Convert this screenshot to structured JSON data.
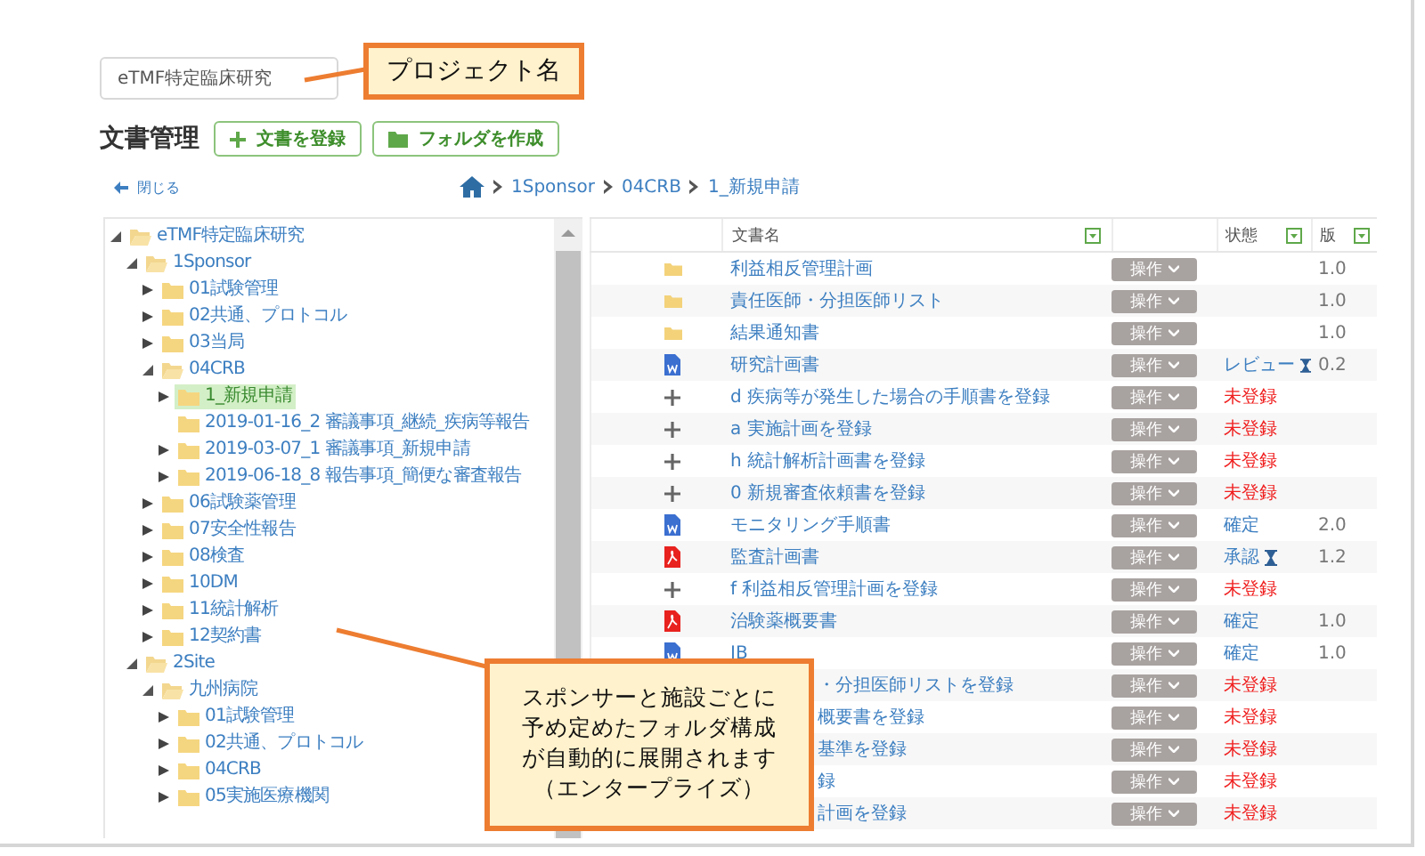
{
  "project_field": {
    "value": "eTMF特定臨床研究"
  },
  "callouts": [
    {
      "kind": "title",
      "text": "プロジェクト名"
    },
    {
      "kind": "note",
      "lines": [
        "スポンサーと施設ごとに",
        "予め定めたフォルダ構成",
        "が自動的に展開されます",
        "（エンタープライズ）"
      ]
    }
  ],
  "heading": "文書管理",
  "buttons": [
    {
      "kind": "add",
      "label": "文書を登録"
    },
    {
      "kind": "folder",
      "label": "フォルダを作成"
    }
  ],
  "close_link": "閉じる",
  "breadcrumb": [
    "1Sponsor",
    "04CRB",
    "1_新規申請"
  ],
  "tree": [
    {
      "label": "eTMF特定臨床研究",
      "expanded": true,
      "selected": false,
      "children": [
        {
          "label": "1Sponsor",
          "expanded": true,
          "selected": false,
          "children": [
            {
              "label": "01試験管理",
              "expanded": false,
              "selected": false
            },
            {
              "label": "02共通、プロトコル",
              "expanded": false,
              "selected": false
            },
            {
              "label": "03当局",
              "expanded": false,
              "selected": false
            },
            {
              "label": "04CRB",
              "expanded": true,
              "selected": false,
              "children": [
                {
                  "label": "1_新規申請",
                  "expanded": false,
                  "selected": true
                },
                {
                  "label": "2019-01-16_2 審議事項_継続_疾病等報告",
                  "selected": false
                },
                {
                  "label": "2019-03-07_1 審議事項_新規申請",
                  "expanded": false,
                  "selected": false
                },
                {
                  "label": "2019-06-18_8 報告事項_簡便な審査報告",
                  "expanded": false,
                  "selected": false
                }
              ]
            },
            {
              "label": "06試験薬管理",
              "expanded": false,
              "selected": false
            },
            {
              "label": "07安全性報告",
              "expanded": false,
              "selected": false
            },
            {
              "label": "08検査",
              "expanded": false,
              "selected": false
            },
            {
              "label": "10DM",
              "expanded": false,
              "selected": false
            },
            {
              "label": "11統計解析",
              "expanded": false,
              "selected": false
            },
            {
              "label": "12契約書",
              "expanded": false,
              "selected": false
            }
          ]
        },
        {
          "label": "2Site",
          "expanded": true,
          "selected": false,
          "children": [
            {
              "label": "九州病院",
              "expanded": true,
              "selected": false,
              "children": [
                {
                  "label": "01試験管理",
                  "expanded": false,
                  "selected": false
                },
                {
                  "label": "02共通、プロトコル",
                  "expanded": false,
                  "selected": false
                },
                {
                  "label": "04CRB",
                  "expanded": false,
                  "selected": false
                },
                {
                  "label": "05実施医療機関",
                  "expanded": false,
                  "selected": false
                }
              ]
            }
          ]
        }
      ]
    }
  ],
  "table": {
    "columns": [
      "文書名",
      "状態",
      "版"
    ],
    "rows": [
      {
        "kind": "folder",
        "name": "利益相反管理計画",
        "action": "操作",
        "version": "1.0"
      },
      {
        "kind": "folder",
        "name": "責任医師・分担医師リスト",
        "action": "操作",
        "version": "1.0"
      },
      {
        "kind": "folder",
        "name": "結果通知書",
        "action": "操作",
        "version": "1.0"
      },
      {
        "kind": "word",
        "name": "研究計画書",
        "action": "操作",
        "status": {
          "text": "レビュー",
          "kind": "pending"
        },
        "version": "0.2"
      },
      {
        "kind": "plus",
        "name": "d 疾病等が発生した場合の手順書を登録",
        "action": "操作",
        "status": {
          "text": "未登録",
          "kind": "missing"
        }
      },
      {
        "kind": "plus",
        "name": "a 実施計画を登録",
        "action": "操作",
        "status": {
          "text": "未登録",
          "kind": "missing"
        }
      },
      {
        "kind": "plus",
        "name": "h 統計解析計画書を登録",
        "action": "操作",
        "status": {
          "text": "未登録",
          "kind": "missing"
        }
      },
      {
        "kind": "plus",
        "name": "0 新規審査依頼書を登録",
        "action": "操作",
        "status": {
          "text": "未登録",
          "kind": "missing"
        }
      },
      {
        "kind": "word",
        "name": "モニタリング手順書",
        "action": "操作",
        "status": {
          "text": "確定",
          "kind": "done"
        },
        "version": "2.0"
      },
      {
        "kind": "pdf",
        "name": "監査計画書",
        "action": "操作",
        "status": {
          "text": "承認",
          "kind": "pending"
        },
        "version": "1.2"
      },
      {
        "kind": "plus",
        "name": "f 利益相反管理計画を登録",
        "action": "操作",
        "status": {
          "text": "未登録",
          "kind": "missing"
        }
      },
      {
        "kind": "pdf",
        "name": "治験薬概要書",
        "action": "操作",
        "status": {
          "text": "確定",
          "kind": "done"
        },
        "version": "1.0"
      },
      {
        "kind": "word",
        "name": "IB",
        "action": "操作",
        "status": {
          "text": "確定",
          "kind": "done"
        },
        "version": "1.0"
      },
      {
        "kind": "covered",
        "name": "・分担医師リストを登録",
        "action": "操作",
        "status": {
          "text": "未登録",
          "kind": "missing"
        }
      },
      {
        "kind": "covered",
        "name": "概要書を登録",
        "action": "操作",
        "status": {
          "text": "未登録",
          "kind": "missing"
        }
      },
      {
        "kind": "covered",
        "name": "基準を登録",
        "action": "操作",
        "status": {
          "text": "未登録",
          "kind": "missing"
        }
      },
      {
        "kind": "covered",
        "name": "録",
        "action": "操作",
        "status": {
          "text": "未登録",
          "kind": "missing"
        }
      },
      {
        "kind": "covered",
        "name": "計画を登録",
        "action": "操作",
        "status": {
          "text": "未登録",
          "kind": "missing"
        }
      }
    ]
  }
}
